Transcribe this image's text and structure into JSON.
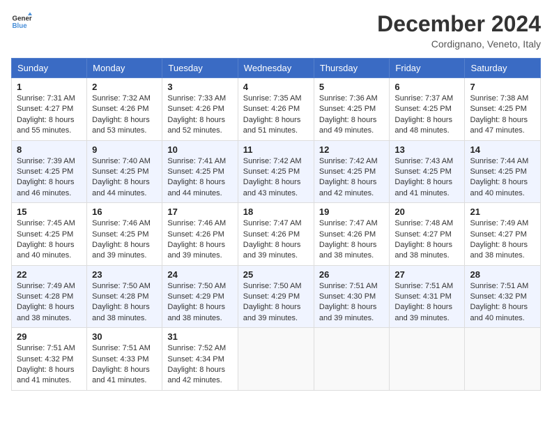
{
  "logo": {
    "line1": "General",
    "line2": "Blue"
  },
  "title": "December 2024",
  "location": "Cordignano, Veneto, Italy",
  "headers": [
    "Sunday",
    "Monday",
    "Tuesday",
    "Wednesday",
    "Thursday",
    "Friday",
    "Saturday"
  ],
  "weeks": [
    [
      {
        "day": "1",
        "sunrise": "7:31 AM",
        "sunset": "4:27 PM",
        "daylight": "8 hours and 55 minutes."
      },
      {
        "day": "2",
        "sunrise": "7:32 AM",
        "sunset": "4:26 PM",
        "daylight": "8 hours and 53 minutes."
      },
      {
        "day": "3",
        "sunrise": "7:33 AM",
        "sunset": "4:26 PM",
        "daylight": "8 hours and 52 minutes."
      },
      {
        "day": "4",
        "sunrise": "7:35 AM",
        "sunset": "4:26 PM",
        "daylight": "8 hours and 51 minutes."
      },
      {
        "day": "5",
        "sunrise": "7:36 AM",
        "sunset": "4:25 PM",
        "daylight": "8 hours and 49 minutes."
      },
      {
        "day": "6",
        "sunrise": "7:37 AM",
        "sunset": "4:25 PM",
        "daylight": "8 hours and 48 minutes."
      },
      {
        "day": "7",
        "sunrise": "7:38 AM",
        "sunset": "4:25 PM",
        "daylight": "8 hours and 47 minutes."
      }
    ],
    [
      {
        "day": "8",
        "sunrise": "7:39 AM",
        "sunset": "4:25 PM",
        "daylight": "8 hours and 46 minutes."
      },
      {
        "day": "9",
        "sunrise": "7:40 AM",
        "sunset": "4:25 PM",
        "daylight": "8 hours and 44 minutes."
      },
      {
        "day": "10",
        "sunrise": "7:41 AM",
        "sunset": "4:25 PM",
        "daylight": "8 hours and 44 minutes."
      },
      {
        "day": "11",
        "sunrise": "7:42 AM",
        "sunset": "4:25 PM",
        "daylight": "8 hours and 43 minutes."
      },
      {
        "day": "12",
        "sunrise": "7:42 AM",
        "sunset": "4:25 PM",
        "daylight": "8 hours and 42 minutes."
      },
      {
        "day": "13",
        "sunrise": "7:43 AM",
        "sunset": "4:25 PM",
        "daylight": "8 hours and 41 minutes."
      },
      {
        "day": "14",
        "sunrise": "7:44 AM",
        "sunset": "4:25 PM",
        "daylight": "8 hours and 40 minutes."
      }
    ],
    [
      {
        "day": "15",
        "sunrise": "7:45 AM",
        "sunset": "4:25 PM",
        "daylight": "8 hours and 40 minutes."
      },
      {
        "day": "16",
        "sunrise": "7:46 AM",
        "sunset": "4:25 PM",
        "daylight": "8 hours and 39 minutes."
      },
      {
        "day": "17",
        "sunrise": "7:46 AM",
        "sunset": "4:26 PM",
        "daylight": "8 hours and 39 minutes."
      },
      {
        "day": "18",
        "sunrise": "7:47 AM",
        "sunset": "4:26 PM",
        "daylight": "8 hours and 39 minutes."
      },
      {
        "day": "19",
        "sunrise": "7:47 AM",
        "sunset": "4:26 PM",
        "daylight": "8 hours and 38 minutes."
      },
      {
        "day": "20",
        "sunrise": "7:48 AM",
        "sunset": "4:27 PM",
        "daylight": "8 hours and 38 minutes."
      },
      {
        "day": "21",
        "sunrise": "7:49 AM",
        "sunset": "4:27 PM",
        "daylight": "8 hours and 38 minutes."
      }
    ],
    [
      {
        "day": "22",
        "sunrise": "7:49 AM",
        "sunset": "4:28 PM",
        "daylight": "8 hours and 38 minutes."
      },
      {
        "day": "23",
        "sunrise": "7:50 AM",
        "sunset": "4:28 PM",
        "daylight": "8 hours and 38 minutes."
      },
      {
        "day": "24",
        "sunrise": "7:50 AM",
        "sunset": "4:29 PM",
        "daylight": "8 hours and 38 minutes."
      },
      {
        "day": "25",
        "sunrise": "7:50 AM",
        "sunset": "4:29 PM",
        "daylight": "8 hours and 39 minutes."
      },
      {
        "day": "26",
        "sunrise": "7:51 AM",
        "sunset": "4:30 PM",
        "daylight": "8 hours and 39 minutes."
      },
      {
        "day": "27",
        "sunrise": "7:51 AM",
        "sunset": "4:31 PM",
        "daylight": "8 hours and 39 minutes."
      },
      {
        "day": "28",
        "sunrise": "7:51 AM",
        "sunset": "4:32 PM",
        "daylight": "8 hours and 40 minutes."
      }
    ],
    [
      {
        "day": "29",
        "sunrise": "7:51 AM",
        "sunset": "4:32 PM",
        "daylight": "8 hours and 41 minutes."
      },
      {
        "day": "30",
        "sunrise": "7:51 AM",
        "sunset": "4:33 PM",
        "daylight": "8 hours and 41 minutes."
      },
      {
        "day": "31",
        "sunrise": "7:52 AM",
        "sunset": "4:34 PM",
        "daylight": "8 hours and 42 minutes."
      },
      null,
      null,
      null,
      null
    ]
  ],
  "labels": {
    "sunrise": "Sunrise:",
    "sunset": "Sunset:",
    "daylight": "Daylight:"
  }
}
